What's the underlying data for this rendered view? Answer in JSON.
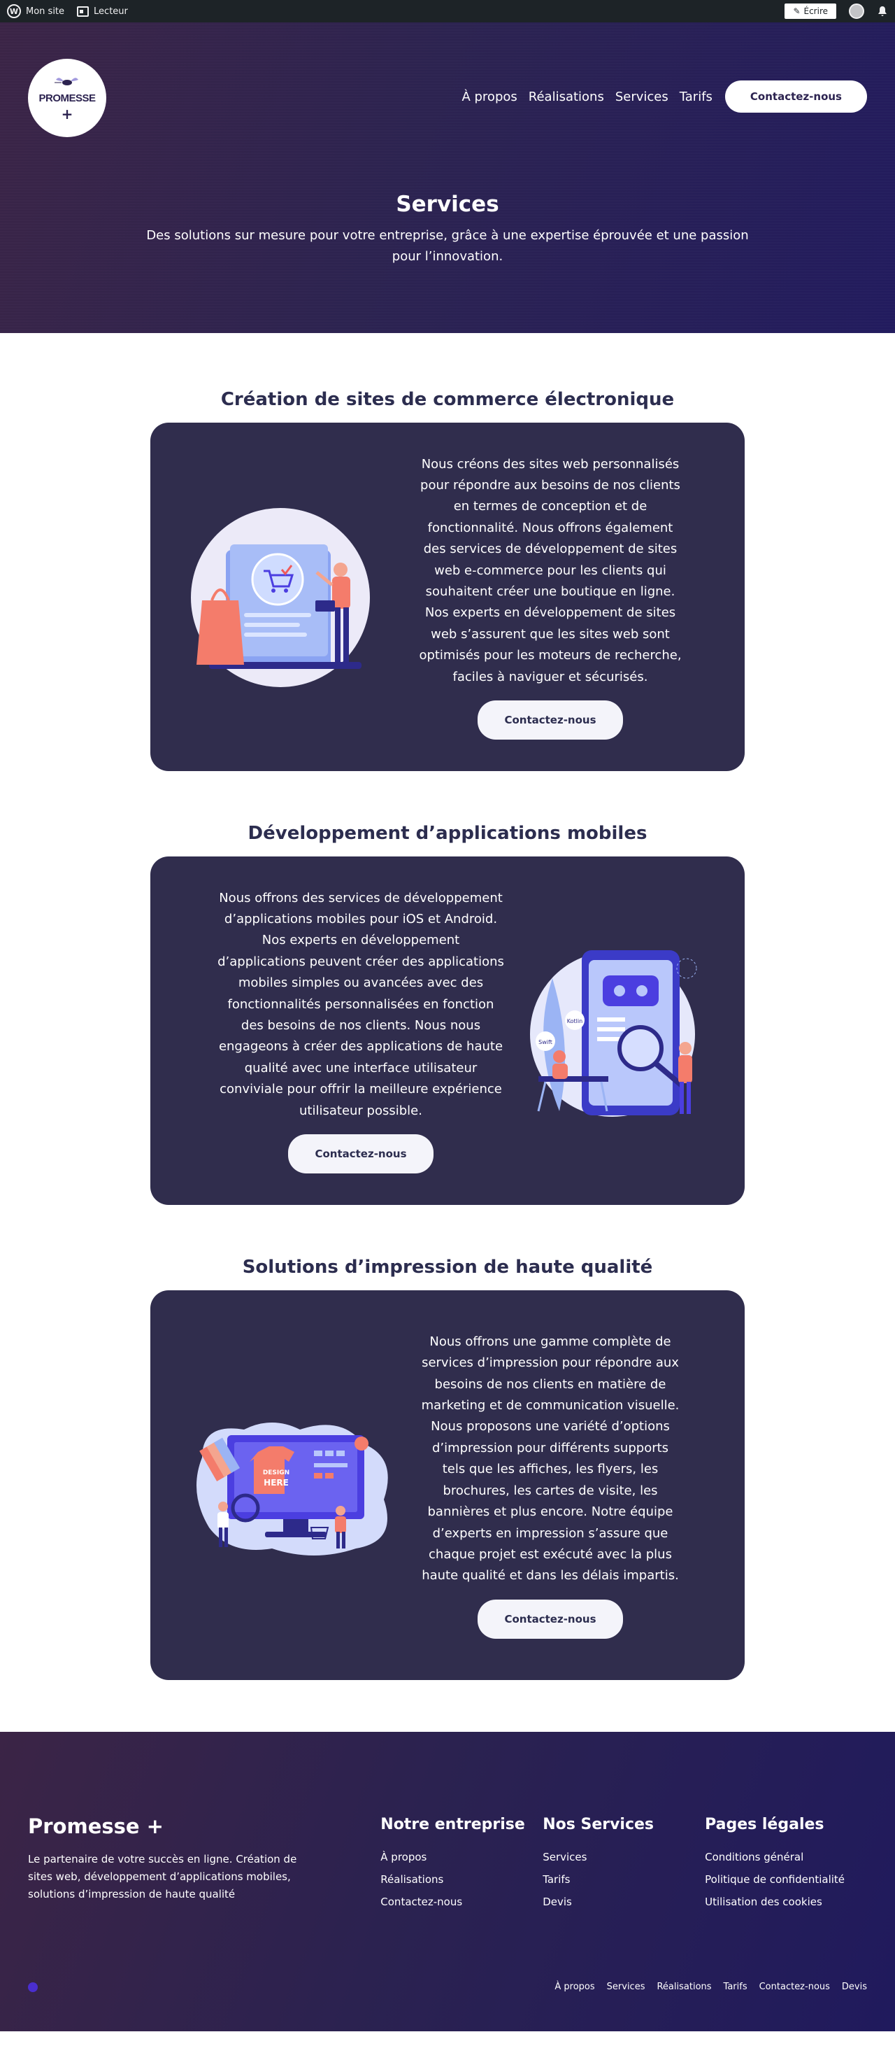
{
  "adminbar": {
    "site_label": "Mon site",
    "reader_label": "Lecteur",
    "write_label": "Écrire",
    "icons": [
      "wordpress-icon",
      "reader-icon",
      "pen-icon",
      "avatar",
      "bell-icon"
    ]
  },
  "header": {
    "logo_text": "PROMESSE",
    "logo_plus": "+",
    "nav": [
      "À propos",
      "Réalisations",
      "Services",
      "Tarifs"
    ],
    "cta": "Contactez-nous"
  },
  "hero": {
    "title": "Services",
    "subtitle": "Des solutions sur mesure pour votre entreprise, grâce à une expertise éprouvée et une passion pour l’innovation."
  },
  "services": [
    {
      "title": "Création de sites de commerce électronique",
      "body": "Nous créons des sites web personnalisés pour répondre aux besoins de nos clients en termes de conception et de fonctionnalité. Nous offrons également des services de développement de sites web e-commerce pour les clients qui souhaitent créer une boutique en ligne. Nos experts en développement de sites web s’assurent que les sites web sont optimisés pour les moteurs de recherche, faciles à naviguer et sécurisés.",
      "button": "Contactez-nous"
    },
    {
      "title": "Développement d’applications mobiles",
      "body": "Nous offrons des services de développement d’applications mobiles pour iOS et Android. Nos experts en développement d’applications peuvent créer des applications mobiles simples ou avancées avec des fonctionnalités personnalisées en fonction des besoins de nos clients. Nous nous engageons à créer des applications de haute qualité avec une interface utilisateur conviviale pour offrir la meilleure expérience utilisateur possible.",
      "button": "Contactez-nous",
      "illus_labels": [
        "Kotlin",
        "Swift"
      ]
    },
    {
      "title": "Solutions d’impression de haute qualité",
      "body": "Nous offrons une gamme complète de services d’impression pour répondre aux besoins de nos clients en matière de marketing et de communication visuelle. Nous proposons une variété d’options d’impression pour différents supports tels que les affiches, les flyers, les brochures, les cartes de visite, les bannières et plus encore. Notre équipe d’experts en impression s’assure que chaque projet est exécuté avec la plus haute qualité et dans les délais impartis.",
      "button": "Contactez-nous",
      "illus_labels": [
        "DESIGN",
        "HERE"
      ]
    }
  ],
  "footer": {
    "brand": "Promesse +",
    "tagline": "Le partenaire de votre succès en ligne. Création de sites web, développement d’applications mobiles, solutions d’impression de haute qualité",
    "columns": [
      {
        "title": "Notre entreprise",
        "links": [
          "À propos",
          "Réalisations",
          "Contactez-nous"
        ]
      },
      {
        "title": "Nos Services",
        "links": [
          "Services",
          "Tarifs",
          "Devis"
        ]
      },
      {
        "title": "Pages légales",
        "links": [
          "Conditions général",
          "Politique de confidentialité",
          "Utilisation des cookies"
        ]
      }
    ],
    "bottom_links": [
      "À propos",
      "Services",
      "Réalisations",
      "Tarifs",
      "Contactez-nous",
      "Devis"
    ]
  },
  "colors": {
    "hero_start": "#3b2446",
    "hero_end": "#221b5e",
    "card_bg": "#302d4d",
    "heading": "#2c2d4f",
    "accent_coral": "#f47c6b",
    "accent_blue": "#4b3ee0"
  }
}
